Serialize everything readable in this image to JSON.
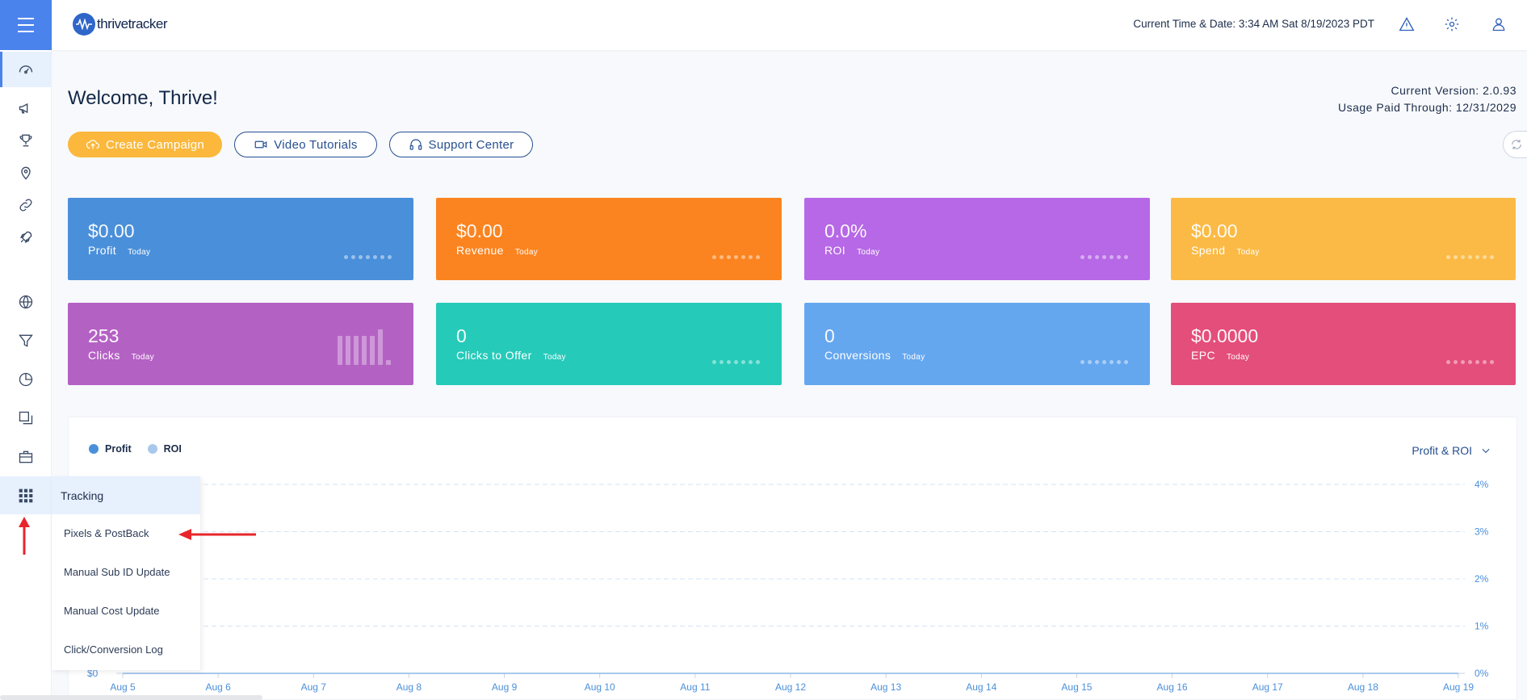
{
  "app": {
    "logo_text": "thrivetracker"
  },
  "header": {
    "datetime": "Current Time & Date: 3:34 AM Sat 8/19/2023 PDT",
    "icons": [
      "alert-icon",
      "gear-icon",
      "user-icon"
    ]
  },
  "sidebar": {
    "items": [
      {
        "icon": "dashboard-icon",
        "active": true
      },
      {
        "icon": "megaphone-icon"
      },
      {
        "icon": "trophy-icon"
      },
      {
        "icon": "location-pin-icon"
      },
      {
        "icon": "link-icon"
      },
      {
        "icon": "rocket-icon"
      },
      {
        "icon": "globe-icon"
      },
      {
        "icon": "funnel-icon"
      },
      {
        "icon": "pie-chart-icon"
      },
      {
        "icon": "copy-icon"
      },
      {
        "icon": "briefcase-icon"
      },
      {
        "icon": "grid-icon"
      }
    ]
  },
  "main": {
    "welcome": "Welcome, Thrive!",
    "version": "Current Version: 2.0.93",
    "paid_through": "Usage Paid Through: 12/31/2029",
    "buttons": {
      "create": "Create Campaign",
      "tutorials": "Video Tutorials",
      "support": "Support Center"
    }
  },
  "cards": [
    {
      "value": "$0.00",
      "label": "Profit",
      "tag": "Today",
      "color": "#4a8fda"
    },
    {
      "value": "$0.00",
      "label": "Revenue",
      "tag": "Today",
      "color": "#fb8420"
    },
    {
      "value": "0.0%",
      "label": "ROI",
      "tag": "Today",
      "color": "#b668e6"
    },
    {
      "value": "$0.00",
      "label": "Spend",
      "tag": "Today",
      "color": "#fbba45"
    },
    {
      "value": "253",
      "label": "Clicks",
      "tag": "Today",
      "color": "#b461c4"
    },
    {
      "value": "0",
      "label": "Clicks to Offer",
      "tag": "Today",
      "color": "#26cab9"
    },
    {
      "value": "0",
      "label": "Conversions",
      "tag": "Today",
      "color": "#65a7ef"
    },
    {
      "value": "$0.0000",
      "label": "EPC",
      "tag": "Today",
      "color": "#e44e7a"
    }
  ],
  "chart_section": {
    "legend": [
      {
        "name": "Profit",
        "color": "#4a8fda"
      },
      {
        "name": "ROI",
        "color": "#a9c8ec"
      }
    ],
    "selector": "Profit & ROI"
  },
  "tracking_menu": {
    "title": "Tracking",
    "items": [
      "Pixels & PostBack",
      "Manual Sub ID Update",
      "Manual Cost Update",
      "Click/Conversion Log"
    ]
  },
  "chart_data": {
    "type": "line",
    "categories": [
      "Aug 5",
      "Aug 6",
      "Aug 7",
      "Aug 8",
      "Aug 9",
      "Aug 10",
      "Aug 11",
      "Aug 12",
      "Aug 13",
      "Aug 14",
      "Aug 15",
      "Aug 16",
      "Aug 17",
      "Aug 18",
      "Aug 19"
    ],
    "series": [
      {
        "name": "Profit",
        "values": [
          0,
          0,
          0,
          0,
          0,
          0,
          0,
          0,
          0,
          0,
          0,
          0,
          0,
          0,
          0
        ]
      },
      {
        "name": "ROI",
        "values": [
          0,
          0,
          0,
          0,
          0,
          0,
          0,
          0,
          0,
          0,
          0,
          0,
          0,
          0,
          0
        ]
      }
    ],
    "y_left_ticks": [
      "$0"
    ],
    "y_right_ticks": [
      "4%",
      "3%",
      "2%",
      "1%",
      "0%"
    ],
    "y_right_lim": [
      0,
      4
    ],
    "grid": true,
    "legend_position": "top-left"
  }
}
